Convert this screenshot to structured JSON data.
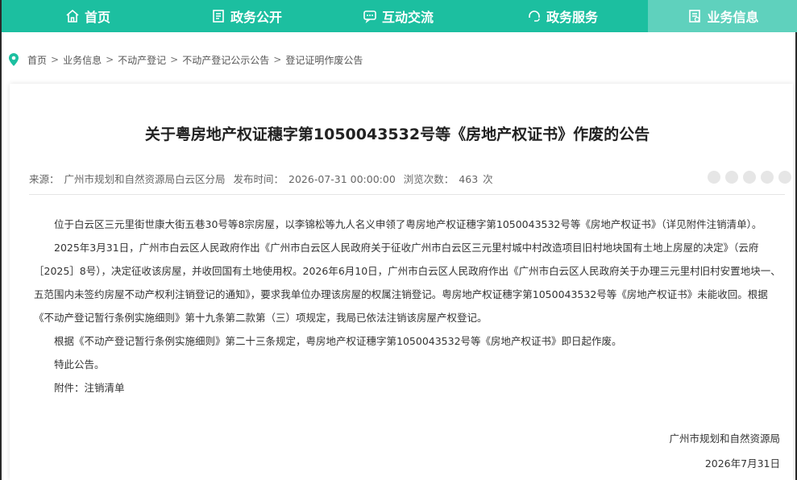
{
  "nav": {
    "items": [
      {
        "label": "首页",
        "icon": "home-icon"
      },
      {
        "label": "政务公开",
        "icon": "document-icon"
      },
      {
        "label": "互动交流",
        "icon": "chat-icon"
      },
      {
        "label": "政务服务",
        "icon": "headset-icon"
      },
      {
        "label": "业务信息",
        "icon": "info-icon"
      }
    ],
    "active_index": 4,
    "colors": {
      "bar": "#1cbfa0",
      "active": "#5fd1bd"
    }
  },
  "breadcrumb": {
    "items": [
      "首页",
      "业务信息",
      "不动产登记",
      "不动产登记公示公告",
      "登记证明作废公告"
    ],
    "separator": ">"
  },
  "article": {
    "title": "关于粤房地产权证穗字第1050043532号等《房地产权证书》作废的公告",
    "meta": {
      "source_label": "来源：",
      "source": "广州市规划和自然资源局白云区分局",
      "publish_label": "发布时间：",
      "publish_time": "2026-07-31 00:00:00",
      "views_label": "浏览次数：",
      "views": "463",
      "views_unit": "次"
    },
    "paragraphs": [
      "位于白云区三元里街世康大街五巷30号等8宗房屋，以李锦松等九人名义申领了粤房地产权证穗字第1050043532号等《房地产权证书》（详见附件注销清单）。",
      "2025年3月31日，广州市白云区人民政府作出《广州市白云区人民政府关于征收广州市白云区三元里村城中村改造项目旧村地块国有土地上房屋的决定》（云府［2025］8号），决定征收该房屋，并收回国有土地使用权。2026年6月10日，广州市白云区人民政府作出《广州市白云区人民政府关于办理三元里村旧村安置地块一、五范围内未签约房屋不动产权利注销登记的通知》，要求我单位办理该房屋的权属注销登记。粤房地产权证穗字第1050043532号等《房地产权证书》未能收回。根据《不动产登记暂行条例实施细则》第十九条第二款第（三）项规定，我局已依法注销该房屋产权登记。",
      "根据《不动产登记暂行条例实施细则》第二十三条规定，粤房地产权证穗字第1050043532号等《房地产权证书》即日起作废。",
      "特此公告。",
      "附件：注销清单"
    ],
    "sign_org": "广州市规划和自然资源局",
    "sign_date": "2026年7月31日"
  }
}
